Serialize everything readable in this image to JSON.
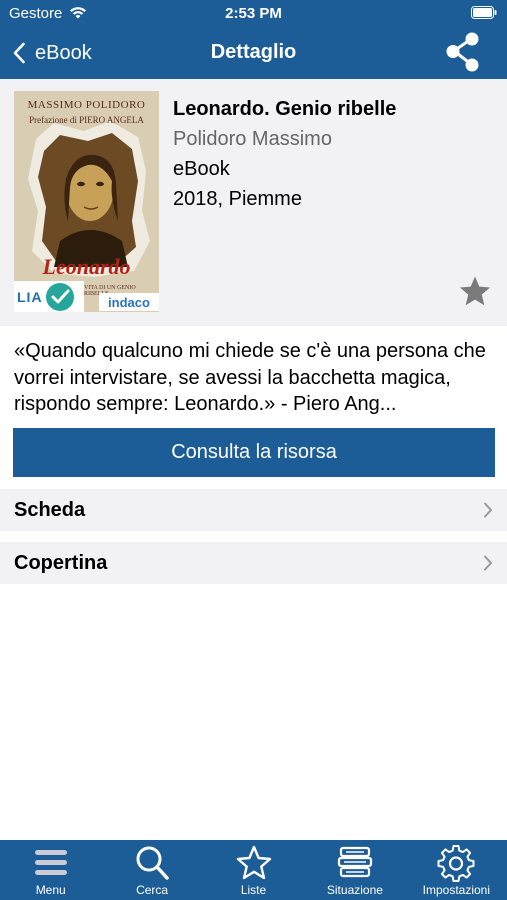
{
  "status_bar": {
    "carrier": "Gestore",
    "time": "2:53 PM"
  },
  "nav": {
    "back_label": "eBook",
    "title": "Dettaglio"
  },
  "book": {
    "title": "Leonardo. Genio ribelle",
    "author": "Polidoro Massimo",
    "format": "eBook",
    "edition": "2018, Piemme",
    "cover": {
      "author": "MASSIMO POLIDORO",
      "preface": "Prefazione di PIERO ANGELA",
      "title": "Leonardo",
      "subtitle": "VITA DI UN GENIO RIBELLE",
      "lia_badge": "LIA",
      "indaco_badge": "indaco"
    }
  },
  "description": "«Quando qualcuno mi chiede se c'è una persona che vorrei intervistare, se avessi la bacchetta magica, rispondo sempre: Leonardo.» - Piero Ang...",
  "actions": {
    "consult_label": "Consulta la risorsa"
  },
  "rows": [
    {
      "label": "Scheda"
    },
    {
      "label": "Copertina"
    }
  ],
  "tab_bar": [
    {
      "label": "Menu",
      "icon": "menu-icon"
    },
    {
      "label": "Cerca",
      "icon": "search-icon"
    },
    {
      "label": "Liste",
      "icon": "star-icon"
    },
    {
      "label": "Situazione",
      "icon": "books-stack-icon"
    },
    {
      "label": "Impostazioni",
      "icon": "gear-icon"
    }
  ],
  "colors": {
    "primary": "#1d5d97",
    "row_background": "#f2f2f4",
    "star": "#7a7a7a",
    "cover_title": "#b62215"
  }
}
